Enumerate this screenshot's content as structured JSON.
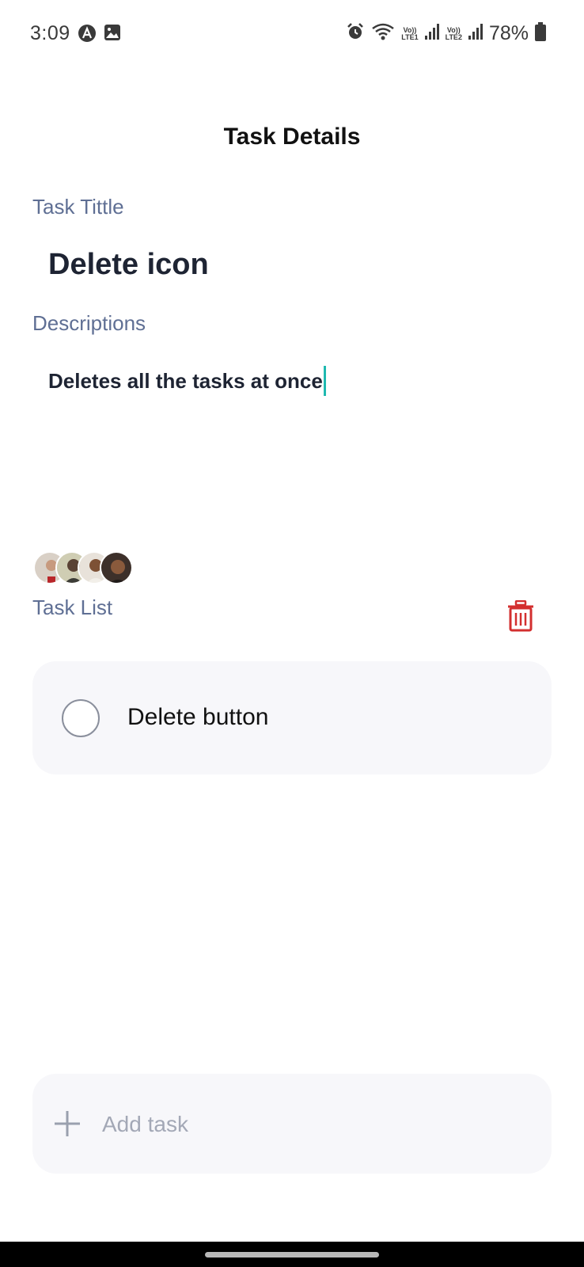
{
  "status_bar": {
    "time": "3:09",
    "battery_percent": "78%",
    "volte1_top": "Vo))",
    "volte1_bottom": "LTE1",
    "volte2_top": "Vo))",
    "volte2_bottom": "LTE2",
    "icons": [
      "android-app-icon",
      "image-icon",
      "alarm-icon",
      "wifi-icon",
      "signal-icon",
      "battery-icon"
    ]
  },
  "header": {
    "title": "Task Details"
  },
  "task_title": {
    "label": "Task Tittle",
    "value": "Delete icon"
  },
  "description": {
    "label": "Descriptions",
    "value": "Deletes all the tasks at once"
  },
  "assignees": {
    "avatars": [
      {
        "name": "avatar-1"
      },
      {
        "name": "avatar-2"
      },
      {
        "name": "avatar-3"
      },
      {
        "name": "avatar-4"
      }
    ]
  },
  "task_list": {
    "label": "Task List",
    "delete_icon": "trash-icon",
    "accent_color": "#d32f2f",
    "items": [
      {
        "label": "Delete button",
        "checked": false
      }
    ]
  },
  "add_task": {
    "placeholder": "Add task"
  }
}
